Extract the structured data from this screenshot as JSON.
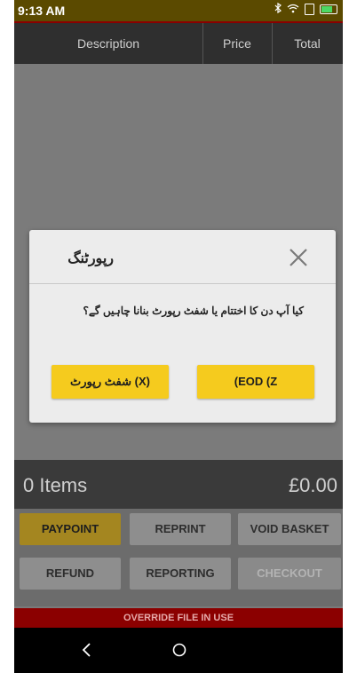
{
  "status_bar": {
    "time": "9:13 AM",
    "bluetooth_icon": "bluetooth-icon",
    "wifi_icon": "wifi-icon",
    "battery_icon": "battery-charging-icon",
    "bar_color": "#5b4a00"
  },
  "basket": {
    "columns": [
      "Description",
      "Price",
      "Total"
    ],
    "items_label": "0 Items",
    "total": "£0.00"
  },
  "buttons": {
    "row1": [
      "PAYPOINT",
      "REPRINT",
      "VOID BASKET"
    ],
    "row2": [
      "REFUND",
      "REPORTING",
      "CHECKOUT"
    ],
    "active": "PAYPOINT",
    "disabled": "CHECKOUT"
  },
  "override": {
    "text": "OVERRIDE FILE IN USE"
  },
  "dialog": {
    "title": "رپورٹنگ",
    "message": "کیا آپ دن کا اختتام یا شفٹ رپورٹ بنانا چاہیں گے؟",
    "shift_button": "شفٹ رپورٹ (X)",
    "eod_button": "(EOD (Z",
    "close_icon": "close-icon",
    "button_color": "#f5cb1e"
  },
  "nav": {
    "back_icon": "back-chevron-icon",
    "home_icon": "home-circle-icon"
  }
}
